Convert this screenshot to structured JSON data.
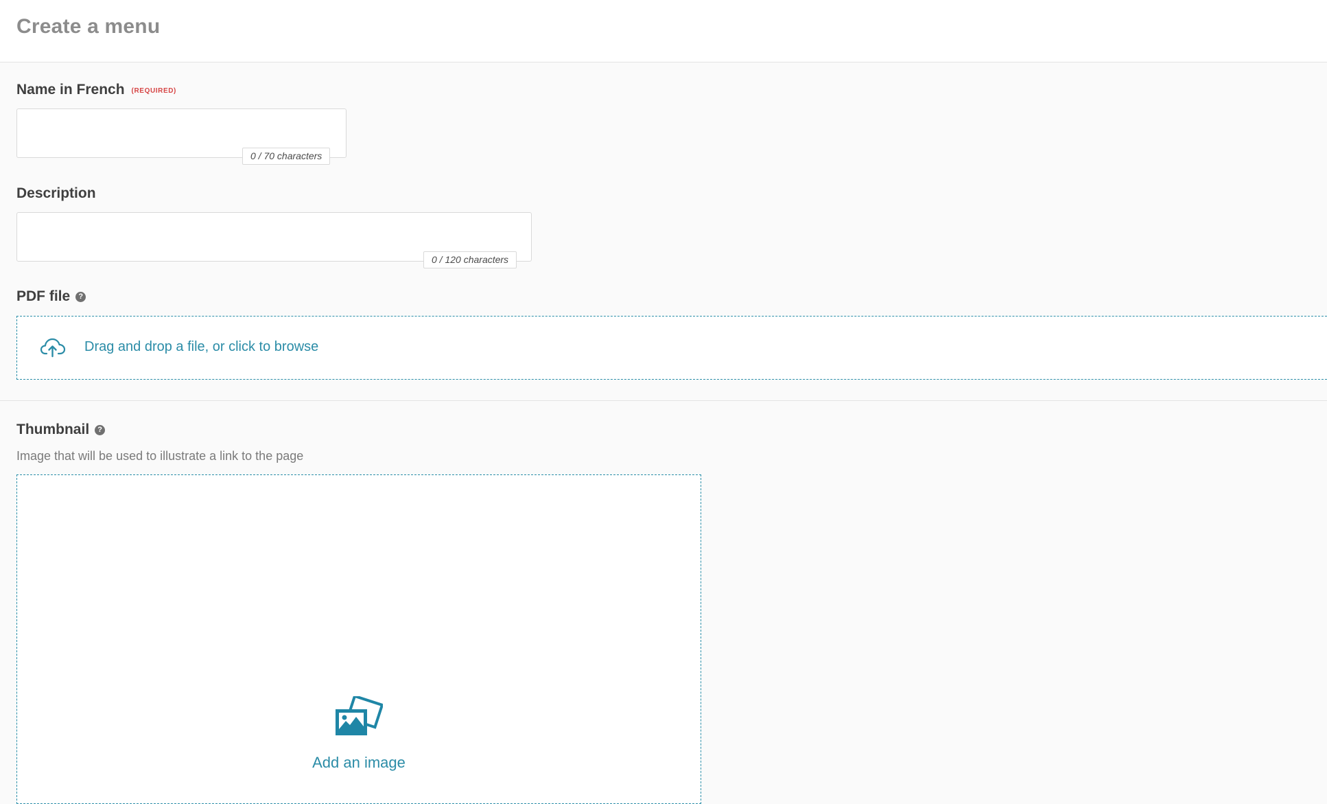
{
  "page": {
    "title": "Create a menu"
  },
  "name_field": {
    "label": "Name in French",
    "required_label": "(REQUIRED)",
    "value": "",
    "counter": "0 / 70 characters"
  },
  "description_field": {
    "label": "Description",
    "value": "",
    "counter": "0 / 120 characters"
  },
  "pdf_field": {
    "label": "PDF file",
    "help_icon": "question-mark-icon",
    "dropzone_text": "Drag and drop a file, or click to browse",
    "upload_icon": "cloud-upload-icon"
  },
  "thumbnail_field": {
    "label": "Thumbnail",
    "help_icon": "question-mark-icon",
    "hint": "Image that will be used to illustrate a link to the page",
    "add_image_label": "Add an image",
    "image_icon": "images-icon"
  },
  "colors": {
    "accent": "#2b8ca7",
    "required": "#d64545",
    "title": "#8c8c8c"
  }
}
